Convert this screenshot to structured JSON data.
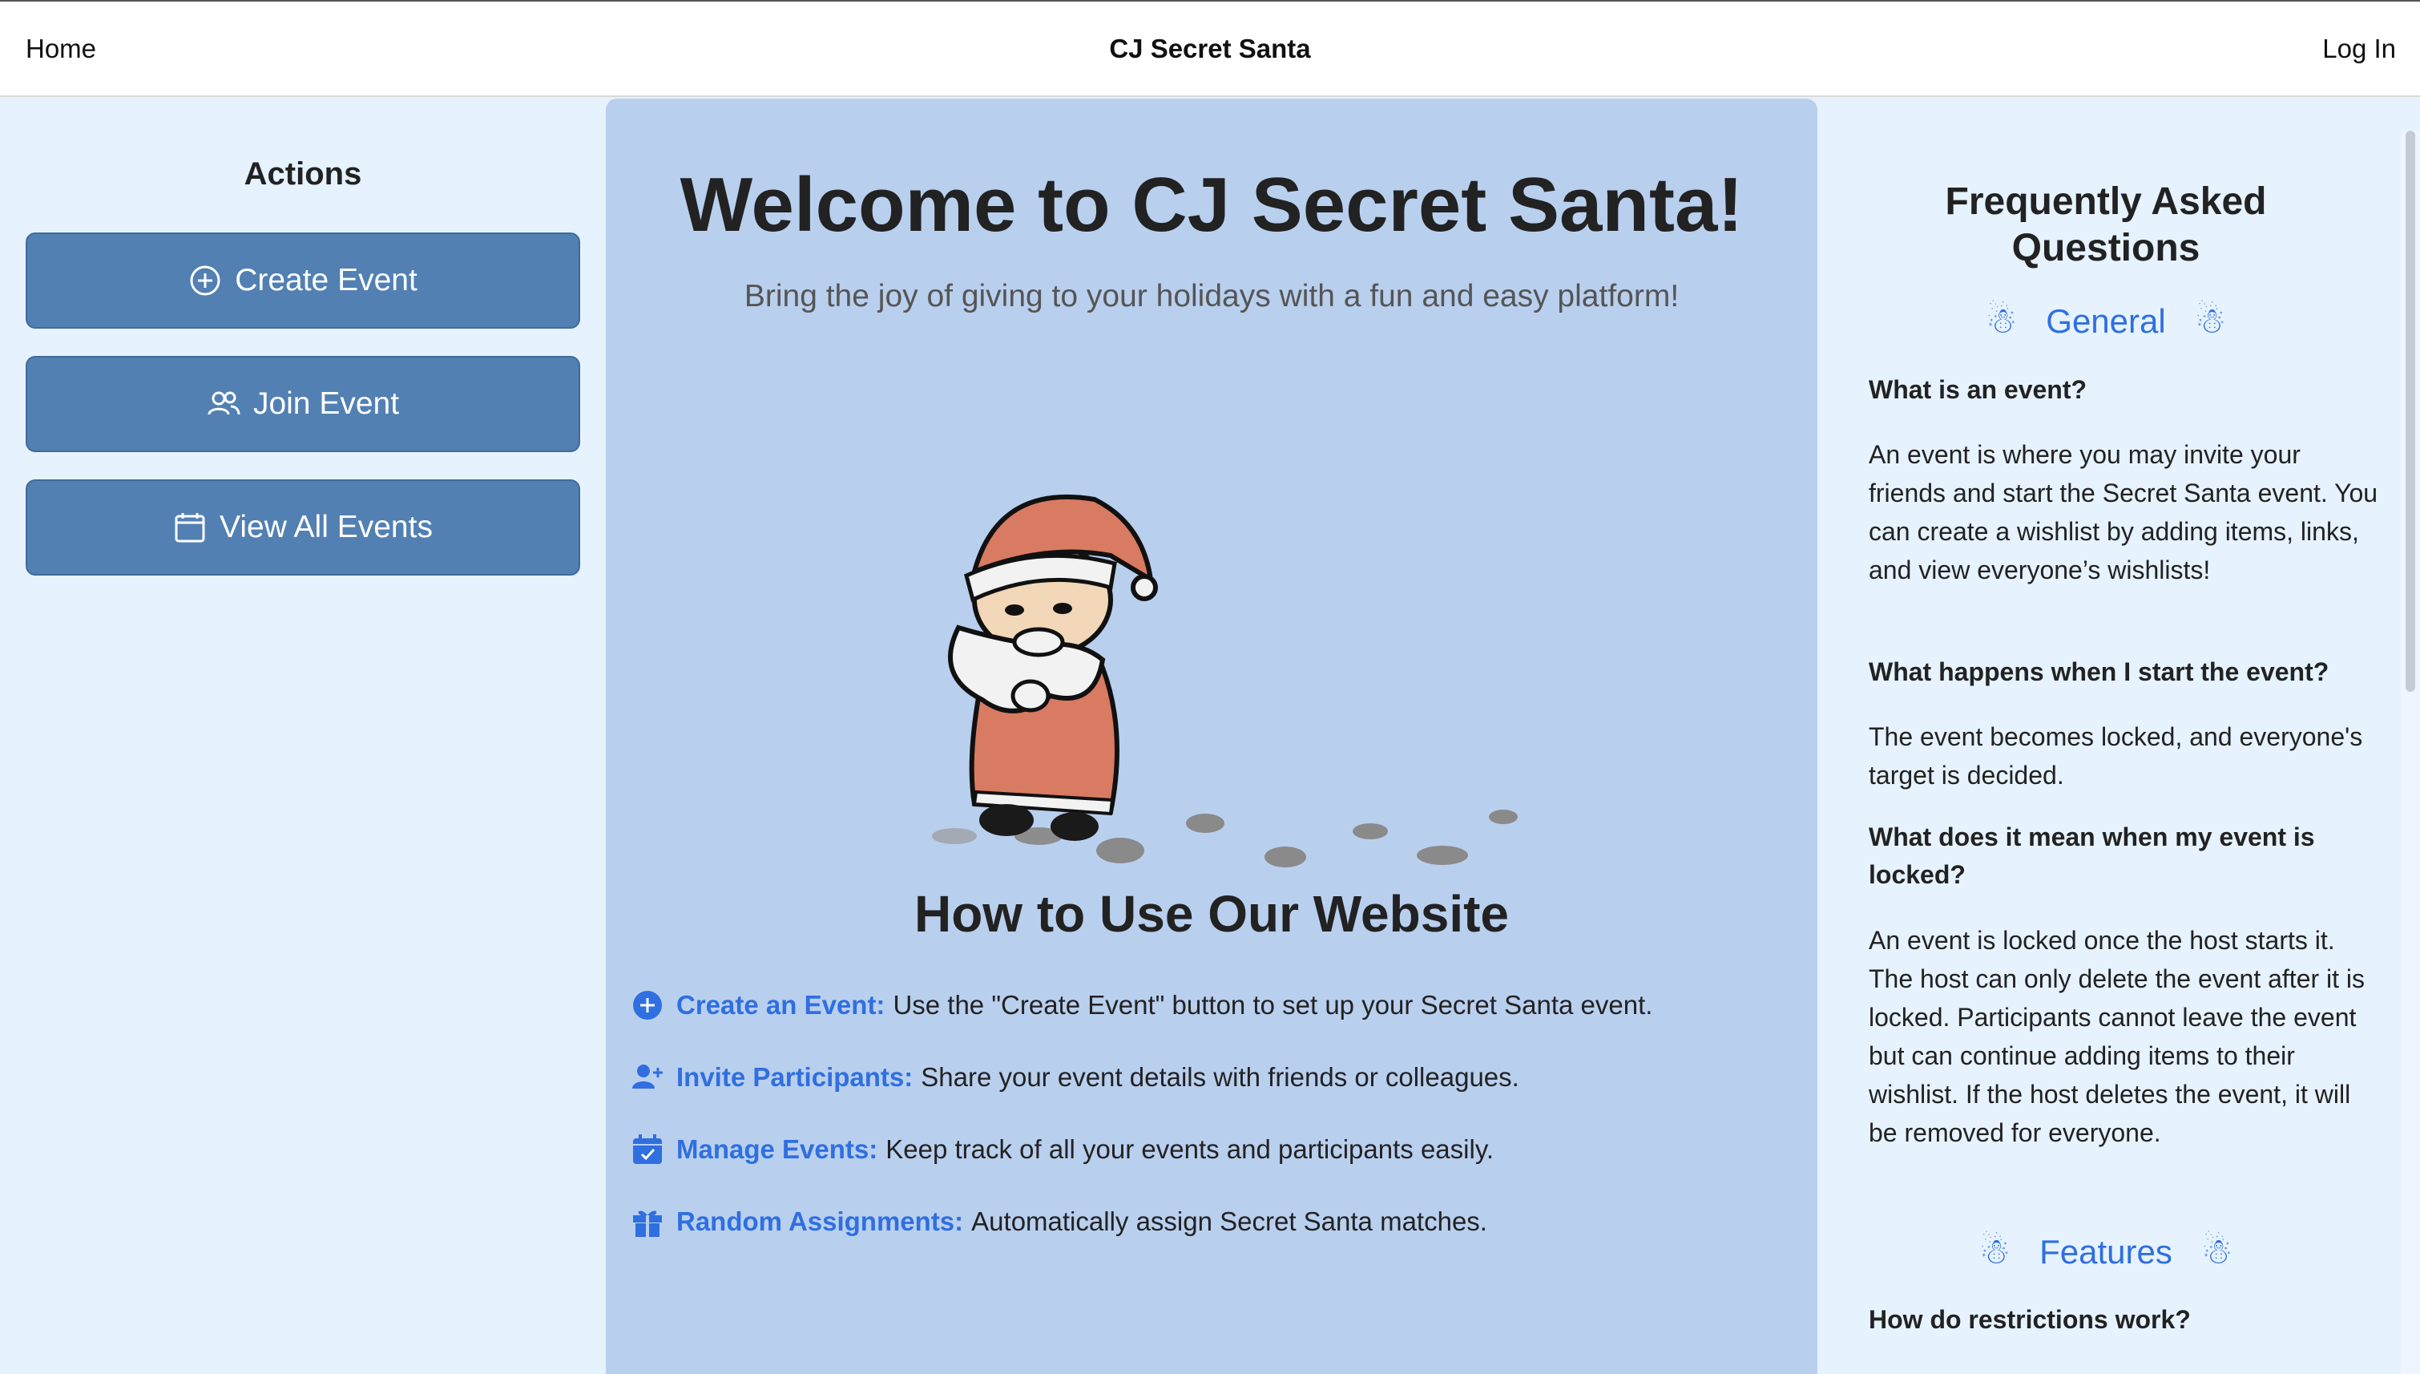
{
  "nav": {
    "home": "Home",
    "title": "CJ Secret Santa",
    "login": "Log In"
  },
  "actions": {
    "title": "Actions",
    "buttons": [
      {
        "label": "Create Event",
        "icon": "plus-circle-icon"
      },
      {
        "label": "Join Event",
        "icon": "people-icon"
      },
      {
        "label": "View All Events",
        "icon": "calendar-icon"
      }
    ]
  },
  "main": {
    "title": "Welcome to CJ Secret Santa!",
    "subtitle": "Bring the joy of giving to your holidays with a fun and easy platform!",
    "how_title": "How to Use Our Website",
    "steps": [
      {
        "label": "Create an Event:",
        "text": "Use the \"Create Event\" button to set up your Secret Santa event.",
        "icon": "plus-circle-icon"
      },
      {
        "label": "Invite Participants:",
        "text": "Share your event details with friends or colleagues.",
        "icon": "person-add-icon"
      },
      {
        "label": "Manage Events:",
        "text": "Keep track of all your events and participants easily.",
        "icon": "calendar-check-icon"
      },
      {
        "label": "Random Assignments:",
        "text": "Automatically assign Secret Santa matches.",
        "icon": "gift-icon"
      }
    ]
  },
  "faq": {
    "title": "Frequently Asked Questions",
    "categories": [
      {
        "name": "General",
        "icon": "snowman-icon",
        "items": [
          {
            "q": "What is an event?",
            "a": "An event is where you may invite your friends and start the Secret Santa event. You can create a wishlist by adding items, links, and view everyone’s wishlists!"
          },
          {
            "q": "What happens when I start the event?",
            "a": "The event becomes locked, and everyone's target is decided."
          },
          {
            "q": "What does it mean when my event is locked?",
            "a": "An event is locked once the host starts it. The host can only delete the event after it is locked. Participants cannot leave the event but can continue adding items to their wishlist. If the host deletes the event, it will be removed for everyone."
          }
        ]
      },
      {
        "name": "Features",
        "icon": "snowman-icon",
        "items": [
          {
            "q": "How do restrictions work?"
          }
        ]
      }
    ]
  },
  "colors": {
    "button_bg": "#5280b3",
    "center_bg": "#b9cfee",
    "page_bg": "#e6f2fd",
    "accent_blue": "#2f6fe0"
  }
}
